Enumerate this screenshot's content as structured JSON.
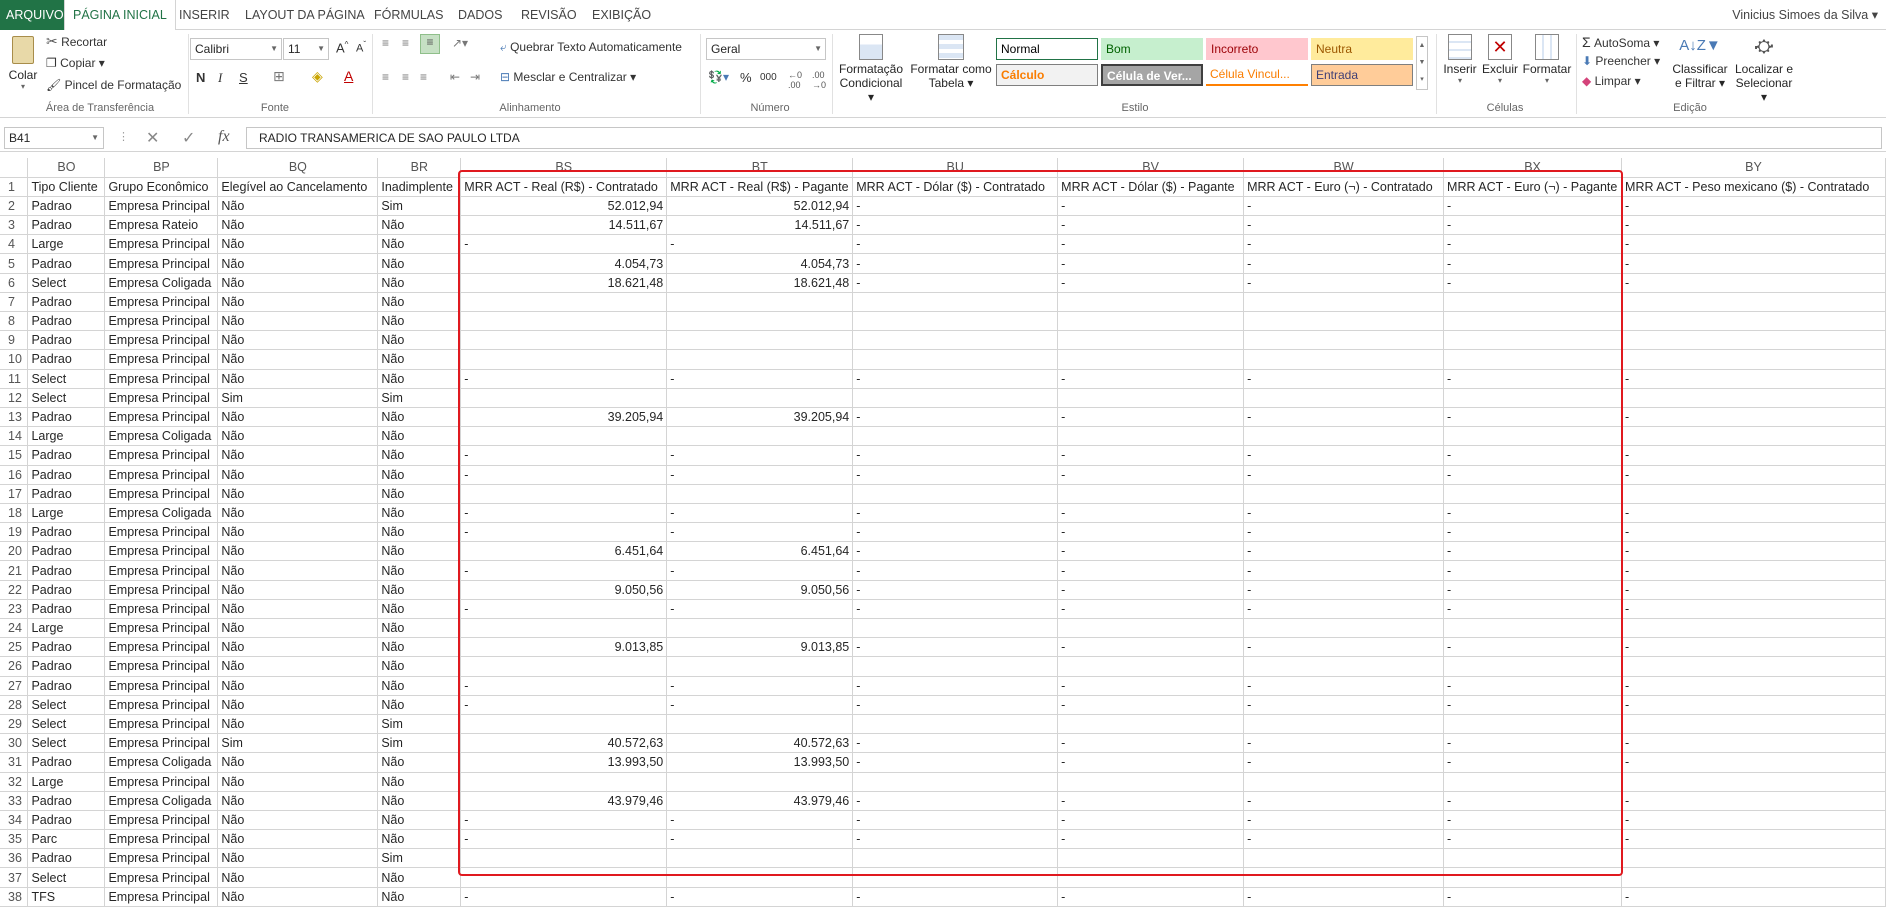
{
  "ribbon_tabs": [
    "ARQUIVO",
    "PÁGINA INICIAL",
    "INSERIR",
    "LAYOUT DA PÁGINA",
    "FÓRMULAS",
    "DADOS",
    "REVISÃO",
    "EXIBIÇÃO"
  ],
  "active_tab": "PÁGINA INICIAL",
  "user_name": "Vinicius Simoes da Silva",
  "clipboard": {
    "paste": "Colar",
    "cut": "Recortar",
    "copy": "Copiar",
    "format_painter": "Pincel de Formatação",
    "group": "Área de Transferência"
  },
  "font": {
    "name": "Calibri",
    "size": "11",
    "bold": "N",
    "italic": "I",
    "underline": "S",
    "group": "Fonte"
  },
  "alignment": {
    "wrap": "Quebrar Texto Automaticamente",
    "merge": "Mesclar e Centralizar",
    "group": "Alinhamento"
  },
  "number": {
    "format": "Geral",
    "percent": "%",
    "thousands": "000",
    "group": "Número"
  },
  "styles": {
    "conditional": [
      "Formatação",
      "Condicional"
    ],
    "as_table": [
      "Formatar como",
      "Tabela"
    ],
    "cells": [
      "Normal",
      "Bom",
      "Incorreto",
      "Neutra",
      "Cálculo",
      "Célula de Ver...",
      "Célula Vincul...",
      "Entrada"
    ],
    "group": "Estilo"
  },
  "cells_group": {
    "insert": "Inserir",
    "delete": "Excluir",
    "format": "Formatar",
    "group": "Células"
  },
  "editing": {
    "autosum": "AutoSoma",
    "fill": "Preencher",
    "clear": "Limpar",
    "sort": [
      "Classificar",
      "e Filtrar"
    ],
    "find": [
      "Localizar e",
      "Selecionar"
    ],
    "group": "Edição"
  },
  "name_box": "B41",
  "formula_icons": [
    "✕",
    "✓",
    "fx"
  ],
  "formula": "RADIO TRANSAMERICA DE SAO PAULO LTDA",
  "columns": [
    "BO",
    "BP",
    "BQ",
    "BR",
    "BS",
    "BT",
    "BU",
    "BV",
    "BW",
    "BX",
    "BY"
  ],
  "header_row": [
    "Tipo Cliente",
    "Grupo Econômico",
    "Elegível ao Cancelamento",
    "Inadimplente",
    "MRR ACT - Real (R$) - Contratado",
    "MRR ACT - Real (R$) - Pagante",
    "MRR ACT - Dólar ($) - Contratado",
    "MRR ACT - Dólar ($) - Pagante",
    "MRR ACT - Euro (¬) - Contratado",
    "MRR ACT - Euro (¬) - Pagante",
    "MRR ACT - Peso mexicano ($) - Contratado"
  ],
  "rows": [
    [
      "Padrao",
      "Empresa Principal",
      "Não",
      "Sim",
      "52.012,94",
      "52.012,94",
      "-",
      "-",
      "-",
      "-",
      "-"
    ],
    [
      "Padrao",
      "Empresa Rateio",
      "Não",
      "Não",
      "14.511,67",
      "14.511,67",
      "-",
      "-",
      "-",
      "-",
      "-"
    ],
    [
      "Large",
      "Empresa Principal",
      "Não",
      "Não",
      "-",
      "-",
      "-",
      "-",
      "-",
      "-",
      "-"
    ],
    [
      "Padrao",
      "Empresa Principal",
      "Não",
      "Não",
      "4.054,73",
      "4.054,73",
      "-",
      "-",
      "-",
      "-",
      "-"
    ],
    [
      "Select",
      "Empresa Coligada",
      "Não",
      "Não",
      "18.621,48",
      "18.621,48",
      "-",
      "-",
      "-",
      "-",
      "-"
    ],
    [
      "Padrao",
      "Empresa Principal",
      "Não",
      "Não",
      "",
      "",
      "",
      "",
      "",
      "",
      ""
    ],
    [
      "Padrao",
      "Empresa Principal",
      "Não",
      "Não",
      "",
      "",
      "",
      "",
      "",
      "",
      ""
    ],
    [
      "Padrao",
      "Empresa Principal",
      "Não",
      "Não",
      "",
      "",
      "",
      "",
      "",
      "",
      ""
    ],
    [
      "Padrao",
      "Empresa Principal",
      "Não",
      "Não",
      "",
      "",
      "",
      "",
      "",
      "",
      ""
    ],
    [
      "Select",
      "Empresa Principal",
      "Não",
      "Não",
      "-",
      "-",
      "-",
      "-",
      "-",
      "-",
      "-"
    ],
    [
      "Select",
      "Empresa Principal",
      "Sim",
      "Sim",
      "",
      "",
      "",
      "",
      "",
      "",
      ""
    ],
    [
      "Padrao",
      "Empresa Principal",
      "Não",
      "Não",
      "39.205,94",
      "39.205,94",
      "-",
      "-",
      "-",
      "-",
      "-"
    ],
    [
      "Large",
      "Empresa Coligada",
      "Não",
      "Não",
      "",
      "",
      "",
      "",
      "",
      "",
      ""
    ],
    [
      "Padrao",
      "Empresa Principal",
      "Não",
      "Não",
      "-",
      "-",
      "-",
      "-",
      "-",
      "-",
      "-"
    ],
    [
      "Padrao",
      "Empresa Principal",
      "Não",
      "Não",
      "-",
      "-",
      "-",
      "-",
      "-",
      "-",
      "-"
    ],
    [
      "Padrao",
      "Empresa Principal",
      "Não",
      "Não",
      "",
      "",
      "",
      "",
      "",
      "",
      ""
    ],
    [
      "Large",
      "Empresa Coligada",
      "Não",
      "Não",
      "-",
      "-",
      "-",
      "-",
      "-",
      "-",
      "-"
    ],
    [
      "Padrao",
      "Empresa Principal",
      "Não",
      "Não",
      "-",
      "-",
      "-",
      "-",
      "-",
      "-",
      "-"
    ],
    [
      "Padrao",
      "Empresa Principal",
      "Não",
      "Não",
      "6.451,64",
      "6.451,64",
      "-",
      "-",
      "-",
      "-",
      "-"
    ],
    [
      "Padrao",
      "Empresa Principal",
      "Não",
      "Não",
      "-",
      "-",
      "-",
      "-",
      "-",
      "-",
      "-"
    ],
    [
      "Padrao",
      "Empresa Principal",
      "Não",
      "Não",
      "9.050,56",
      "9.050,56",
      "-",
      "-",
      "-",
      "-",
      "-"
    ],
    [
      "Padrao",
      "Empresa Principal",
      "Não",
      "Não",
      "-",
      "-",
      "-",
      "-",
      "-",
      "-",
      "-"
    ],
    [
      "Large",
      "Empresa Principal",
      "Não",
      "Não",
      "",
      "",
      "",
      "",
      "",
      "",
      ""
    ],
    [
      "Padrao",
      "Empresa Principal",
      "Não",
      "Não",
      "9.013,85",
      "9.013,85",
      "-",
      "-",
      "-",
      "-",
      "-"
    ],
    [
      "Padrao",
      "Empresa Principal",
      "Não",
      "Não",
      "",
      "",
      "",
      "",
      "",
      "",
      ""
    ],
    [
      "Padrao",
      "Empresa Principal",
      "Não",
      "Não",
      "-",
      "-",
      "-",
      "-",
      "-",
      "-",
      "-"
    ],
    [
      "Select",
      "Empresa Principal",
      "Não",
      "Não",
      "-",
      "-",
      "-",
      "-",
      "-",
      "-",
      "-"
    ],
    [
      "Select",
      "Empresa Principal",
      "Não",
      "Sim",
      "",
      "",
      "",
      "",
      "",
      "",
      ""
    ],
    [
      "Select",
      "Empresa Principal",
      "Sim",
      "Sim",
      "40.572,63",
      "40.572,63",
      "-",
      "-",
      "-",
      "-",
      "-"
    ],
    [
      "Padrao",
      "Empresa Coligada",
      "Não",
      "Não",
      "13.993,50",
      "13.993,50",
      "-",
      "-",
      "-",
      "-",
      "-"
    ],
    [
      "Large",
      "Empresa Principal",
      "Não",
      "Não",
      "",
      "",
      "",
      "",
      "",
      "",
      ""
    ],
    [
      "Padrao",
      "Empresa Coligada",
      "Não",
      "Não",
      "43.979,46",
      "43.979,46",
      "-",
      "-",
      "-",
      "-",
      "-"
    ],
    [
      "Padrao",
      "Empresa Principal",
      "Não",
      "Não",
      "-",
      "-",
      "-",
      "-",
      "-",
      "-",
      "-"
    ],
    [
      "Parc",
      "Empresa Principal",
      "Não",
      "Não",
      "-",
      "-",
      "-",
      "-",
      "-",
      "-",
      "-"
    ],
    [
      "Padrao",
      "Empresa Principal",
      "Não",
      "Sim",
      "",
      "",
      "",
      "",
      "",
      "",
      ""
    ],
    [
      "Select",
      "Empresa Principal",
      "Não",
      "Não",
      "",
      "",
      "",
      "",
      "",
      "",
      ""
    ],
    [
      "TFS",
      "Empresa Principal",
      "Não",
      "Não",
      "-",
      "-",
      "-",
      "-",
      "-",
      "-",
      "-"
    ]
  ],
  "accent": "#217346",
  "highlight_color": "#e0191f"
}
